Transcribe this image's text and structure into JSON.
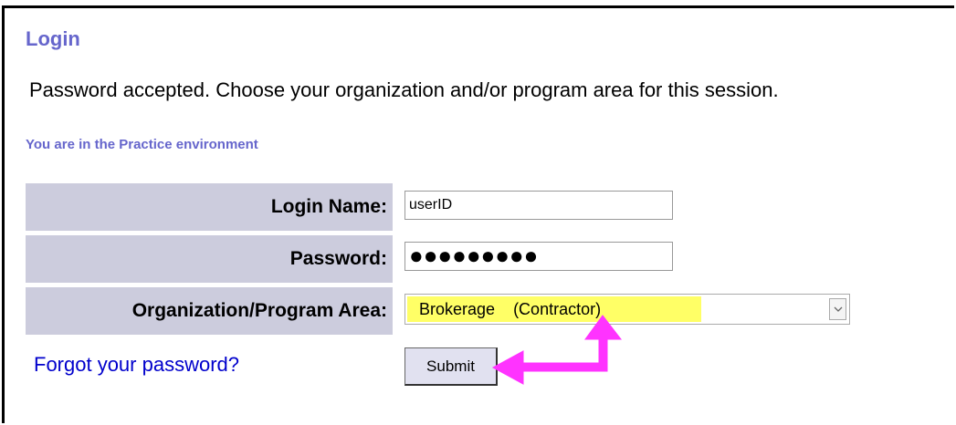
{
  "header": {
    "title": "Login"
  },
  "message": "Password accepted. Choose your organization and/or program area for this session.",
  "environment_note": "You are in the Practice environment",
  "form": {
    "login_name_label": "Login Name:",
    "login_name_value": "userID",
    "password_label": "Password:",
    "password_masked": "●●●●●●●●●",
    "org_label": "Organization/Program Area:",
    "org_selected": "Brokerage",
    "org_selected_sub": "(Contractor)",
    "dropdown_icon": "chevron-down-icon",
    "highlight_color": "#ffff66"
  },
  "links": {
    "forgot_password": "Forgot your password?"
  },
  "buttons": {
    "submit": "Submit"
  },
  "annotation": {
    "arrow_color": "#ff33ff"
  }
}
